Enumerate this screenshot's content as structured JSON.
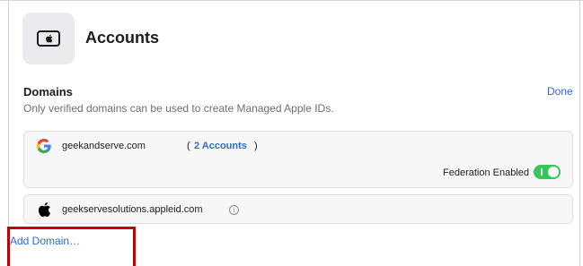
{
  "header": {
    "title": "Accounts",
    "icon": "credit-card-apple-icon"
  },
  "domains_section": {
    "title": "Domains",
    "done_label": "Done",
    "description": "Only verified domains can be used to create Managed Apple IDs."
  },
  "domains": [
    {
      "icon": "google-icon",
      "name": "geekandserve.com",
      "accounts_open": "(",
      "accounts_link": "2 Accounts",
      "accounts_close": ")",
      "federation_label": "Federation Enabled",
      "federation_enabled": true
    },
    {
      "icon": "apple-icon",
      "name": "geekservesolutions.appleid.com",
      "info_icon": "info-icon",
      "info_glyph": "i"
    }
  ],
  "add_domain_label": "Add Domain…",
  "colors": {
    "accent": "#2c6bd1",
    "toggle_on": "#34c759",
    "highlight": "#c40000",
    "card_bg": "#f7f7f7"
  }
}
